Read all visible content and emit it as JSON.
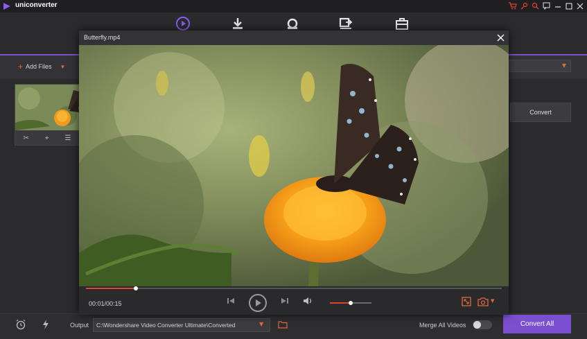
{
  "app": {
    "title": "uniconverter"
  },
  "toolbar": {
    "icons": [
      "convert-icon",
      "download-icon",
      "record-icon",
      "transfer-icon",
      "toolbox-icon"
    ]
  },
  "files": {
    "add_files_label": "Add Files",
    "convert_label": "Convert"
  },
  "player": {
    "title": "Butterfly.mp4",
    "time_readout": "00:01/00:15",
    "progress_percent": 12,
    "volume_percent": 50
  },
  "bottom": {
    "output_label": "Output",
    "output_path": "C:\\Wondershare Video Converter Ultimate\\Converted",
    "merge_label": "Merge All Videos",
    "merge_enabled": false,
    "convert_all_label": "Convert All"
  },
  "colors": {
    "accent": "#7b4fd0",
    "highlight": "#e06a3f",
    "progress": "#e0442c"
  }
}
